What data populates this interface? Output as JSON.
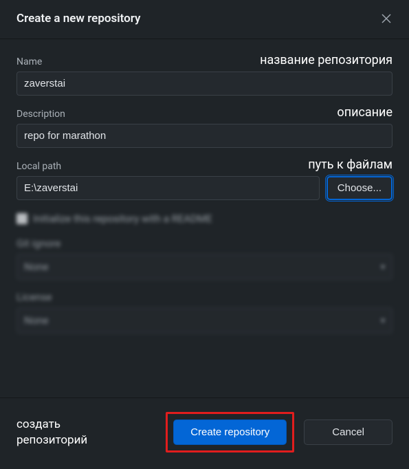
{
  "header": {
    "title": "Create a new repository"
  },
  "fields": {
    "name": {
      "label": "Name",
      "value": "zaverstai",
      "annotation": "название репозитория"
    },
    "description": {
      "label": "Description",
      "value": "repo for marathon",
      "annotation": "описание"
    },
    "path": {
      "label": "Local path",
      "value": "E:\\zaverstai",
      "annotation": "путь к файлам",
      "choose_label": "Choose..."
    },
    "readme": {
      "label": "Initialize this repository with a README"
    },
    "gitignore": {
      "label": "Git ignore",
      "value": "None"
    },
    "license": {
      "label": "License",
      "value": "None"
    }
  },
  "footer": {
    "annotation": "создать\nрепозиторий",
    "create_label": "Create repository",
    "cancel_label": "Cancel"
  }
}
